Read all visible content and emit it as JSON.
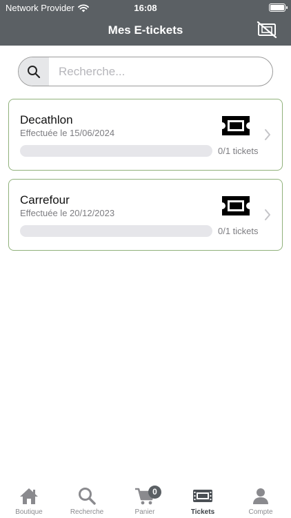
{
  "status": {
    "carrier": "Network Provider",
    "time": "16:08"
  },
  "header": {
    "title": "Mes E-tickets"
  },
  "search": {
    "placeholder": "Recherche..."
  },
  "tickets": [
    {
      "name": "Decathlon",
      "date": "Effectuée le 15/06/2024",
      "count": "0/1 tickets",
      "progress_pct": 0
    },
    {
      "name": "Carrefour",
      "date": "Effectuée le 20/12/2023",
      "count": "0/1 tickets",
      "progress_pct": 0
    }
  ],
  "tabs": [
    {
      "label": "Boutique",
      "icon": "home-icon",
      "active": false
    },
    {
      "label": "Recherche",
      "icon": "search-icon",
      "active": false
    },
    {
      "label": "Panier",
      "icon": "cart-icon",
      "active": false,
      "badge": "0"
    },
    {
      "label": "Tickets",
      "icon": "ticket-icon",
      "active": true
    },
    {
      "label": "Compte",
      "icon": "user-icon",
      "active": false
    }
  ],
  "colors": {
    "bar": "#5b6064",
    "card_border": "#8fb17a",
    "muted": "#7c7c80"
  }
}
